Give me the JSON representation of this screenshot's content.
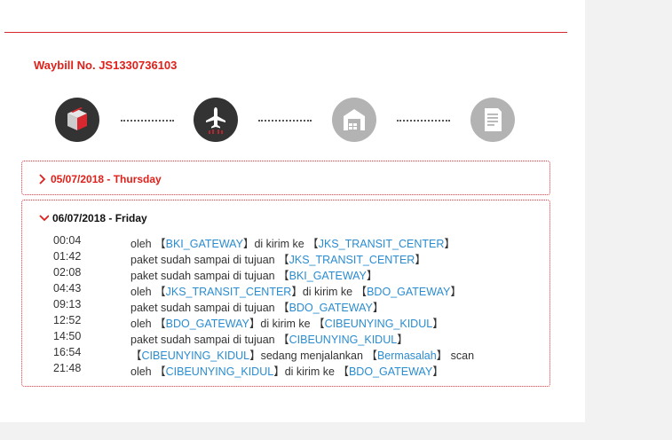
{
  "waybill": {
    "label": "Waybill No. JS1330736103"
  },
  "steps": [
    "package-icon",
    "airplane-icon",
    "warehouse-icon",
    "document-icon"
  ],
  "colors": {
    "accent": "#e0201a",
    "link": "#2a8cd0",
    "dark_icon": "#333333",
    "inactive_icon": "#b3b3b3"
  },
  "days": [
    {
      "date": "05/07/2018 - Thursday",
      "expanded": false
    },
    {
      "date": "06/07/2018 - Friday",
      "expanded": true,
      "events": [
        {
          "time": "00:04",
          "text": [
            "oleh ",
            "【",
            "BKI_GATEWAY",
            "】",
            "di kirim ke ",
            "【",
            "JKS_TRANSIT_CENTER",
            "】"
          ]
        },
        {
          "time": "01:42",
          "text": [
            "paket sudah sampai di tujuan ",
            "【",
            "JKS_TRANSIT_CENTER",
            "】"
          ]
        },
        {
          "time": "02:08",
          "text": [
            "paket sudah sampai di tujuan ",
            "【",
            "BKI_GATEWAY",
            "】"
          ]
        },
        {
          "time": "04:43",
          "text": [
            "oleh ",
            "【",
            "JKS_TRANSIT_CENTER",
            "】",
            "di kirim ke ",
            "【",
            "BDO_GATEWAY",
            "】"
          ]
        },
        {
          "time": "09:13",
          "text": [
            "paket sudah sampai di tujuan ",
            "【",
            "BDO_GATEWAY",
            "】"
          ]
        },
        {
          "time": "12:52",
          "text": [
            "oleh ",
            "【",
            "BDO_GATEWAY",
            "】",
            "di kirim ke ",
            "【",
            "CIBEUNYING_KIDUL",
            "】"
          ]
        },
        {
          "time": "14:50",
          "text": [
            "paket sudah sampai di tujuan ",
            "【",
            "CIBEUNYING_KIDUL",
            "】"
          ]
        },
        {
          "time": "16:54",
          "text": [
            "【",
            "CIBEUNYING_KIDUL",
            "】",
            "sedang menjalankan ",
            "【",
            "Bermasalah",
            "】",
            " scan"
          ]
        },
        {
          "time": "21:48",
          "text": [
            "oleh ",
            "【",
            "CIBEUNYING_KIDUL",
            "】",
            "di kirim ke ",
            "【",
            "BDO_GATEWAY",
            "】"
          ]
        }
      ]
    }
  ]
}
